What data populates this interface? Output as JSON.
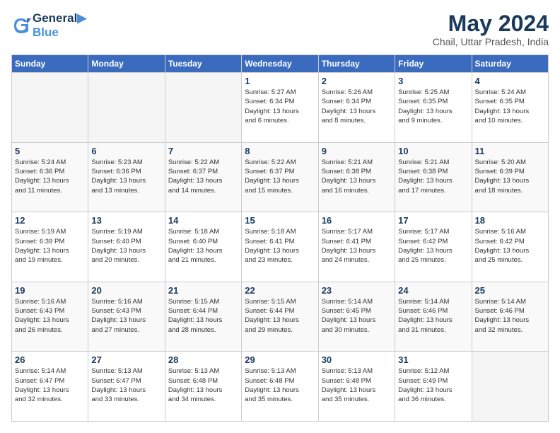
{
  "header": {
    "logo_line1": "General",
    "logo_line2": "Blue",
    "month_year": "May 2024",
    "location": "Chail, Uttar Pradesh, India"
  },
  "days_of_week": [
    "Sunday",
    "Monday",
    "Tuesday",
    "Wednesday",
    "Thursday",
    "Friday",
    "Saturday"
  ],
  "weeks": [
    [
      {
        "num": "",
        "detail": ""
      },
      {
        "num": "",
        "detail": ""
      },
      {
        "num": "",
        "detail": ""
      },
      {
        "num": "1",
        "detail": "Sunrise: 5:27 AM\nSunset: 6:34 PM\nDaylight: 13 hours\nand 6 minutes."
      },
      {
        "num": "2",
        "detail": "Sunrise: 5:26 AM\nSunset: 6:34 PM\nDaylight: 13 hours\nand 8 minutes."
      },
      {
        "num": "3",
        "detail": "Sunrise: 5:25 AM\nSunset: 6:35 PM\nDaylight: 13 hours\nand 9 minutes."
      },
      {
        "num": "4",
        "detail": "Sunrise: 5:24 AM\nSunset: 6:35 PM\nDaylight: 13 hours\nand 10 minutes."
      }
    ],
    [
      {
        "num": "5",
        "detail": "Sunrise: 5:24 AM\nSunset: 6:36 PM\nDaylight: 13 hours\nand 11 minutes."
      },
      {
        "num": "6",
        "detail": "Sunrise: 5:23 AM\nSunset: 6:36 PM\nDaylight: 13 hours\nand 13 minutes."
      },
      {
        "num": "7",
        "detail": "Sunrise: 5:22 AM\nSunset: 6:37 PM\nDaylight: 13 hours\nand 14 minutes."
      },
      {
        "num": "8",
        "detail": "Sunrise: 5:22 AM\nSunset: 6:37 PM\nDaylight: 13 hours\nand 15 minutes."
      },
      {
        "num": "9",
        "detail": "Sunrise: 5:21 AM\nSunset: 6:38 PM\nDaylight: 13 hours\nand 16 minutes."
      },
      {
        "num": "10",
        "detail": "Sunrise: 5:21 AM\nSunset: 6:38 PM\nDaylight: 13 hours\nand 17 minutes."
      },
      {
        "num": "11",
        "detail": "Sunrise: 5:20 AM\nSunset: 6:39 PM\nDaylight: 13 hours\nand 18 minutes."
      }
    ],
    [
      {
        "num": "12",
        "detail": "Sunrise: 5:19 AM\nSunset: 6:39 PM\nDaylight: 13 hours\nand 19 minutes."
      },
      {
        "num": "13",
        "detail": "Sunrise: 5:19 AM\nSunset: 6:40 PM\nDaylight: 13 hours\nand 20 minutes."
      },
      {
        "num": "14",
        "detail": "Sunrise: 5:18 AM\nSunset: 6:40 PM\nDaylight: 13 hours\nand 21 minutes."
      },
      {
        "num": "15",
        "detail": "Sunrise: 5:18 AM\nSunset: 6:41 PM\nDaylight: 13 hours\nand 23 minutes."
      },
      {
        "num": "16",
        "detail": "Sunrise: 5:17 AM\nSunset: 6:41 PM\nDaylight: 13 hours\nand 24 minutes."
      },
      {
        "num": "17",
        "detail": "Sunrise: 5:17 AM\nSunset: 6:42 PM\nDaylight: 13 hours\nand 25 minutes."
      },
      {
        "num": "18",
        "detail": "Sunrise: 5:16 AM\nSunset: 6:42 PM\nDaylight: 13 hours\nand 25 minutes."
      }
    ],
    [
      {
        "num": "19",
        "detail": "Sunrise: 5:16 AM\nSunset: 6:43 PM\nDaylight: 13 hours\nand 26 minutes."
      },
      {
        "num": "20",
        "detail": "Sunrise: 5:16 AM\nSunset: 6:43 PM\nDaylight: 13 hours\nand 27 minutes."
      },
      {
        "num": "21",
        "detail": "Sunrise: 5:15 AM\nSunset: 6:44 PM\nDaylight: 13 hours\nand 28 minutes."
      },
      {
        "num": "22",
        "detail": "Sunrise: 5:15 AM\nSunset: 6:44 PM\nDaylight: 13 hours\nand 29 minutes."
      },
      {
        "num": "23",
        "detail": "Sunrise: 5:14 AM\nSunset: 6:45 PM\nDaylight: 13 hours\nand 30 minutes."
      },
      {
        "num": "24",
        "detail": "Sunrise: 5:14 AM\nSunset: 6:46 PM\nDaylight: 13 hours\nand 31 minutes."
      },
      {
        "num": "25",
        "detail": "Sunrise: 5:14 AM\nSunset: 6:46 PM\nDaylight: 13 hours\nand 32 minutes."
      }
    ],
    [
      {
        "num": "26",
        "detail": "Sunrise: 5:14 AM\nSunset: 6:47 PM\nDaylight: 13 hours\nand 32 minutes."
      },
      {
        "num": "27",
        "detail": "Sunrise: 5:13 AM\nSunset: 6:47 PM\nDaylight: 13 hours\nand 33 minutes."
      },
      {
        "num": "28",
        "detail": "Sunrise: 5:13 AM\nSunset: 6:48 PM\nDaylight: 13 hours\nand 34 minutes."
      },
      {
        "num": "29",
        "detail": "Sunrise: 5:13 AM\nSunset: 6:48 PM\nDaylight: 13 hours\nand 35 minutes."
      },
      {
        "num": "30",
        "detail": "Sunrise: 5:13 AM\nSunset: 6:48 PM\nDaylight: 13 hours\nand 35 minutes."
      },
      {
        "num": "31",
        "detail": "Sunrise: 5:12 AM\nSunset: 6:49 PM\nDaylight: 13 hours\nand 36 minutes."
      },
      {
        "num": "",
        "detail": ""
      }
    ]
  ]
}
